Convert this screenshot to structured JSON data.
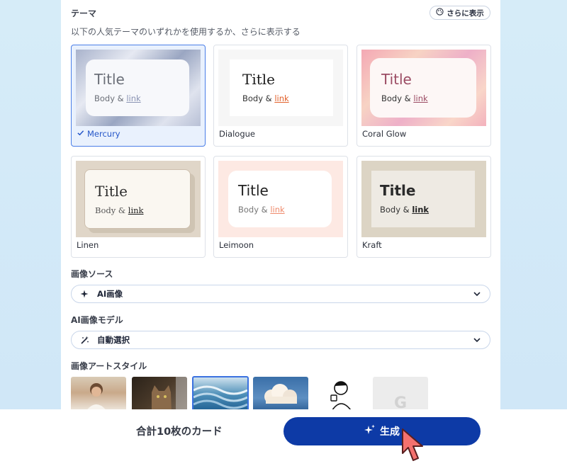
{
  "theme_section": {
    "title": "テーマ",
    "subtitle": "以下の人気テーマのいずれかを使用するか、さらに表示する",
    "more_button": "さらに表示",
    "more_icon": "palette-icon",
    "themes": [
      {
        "name": "Mercury",
        "title": "Title",
        "body": "Body &",
        "link": "link",
        "selected": true
      },
      {
        "name": "Dialogue",
        "title": "Title",
        "body": "Body &",
        "link": "link",
        "selected": false
      },
      {
        "name": "Coral Glow",
        "title": "Title",
        "body": "Body &",
        "link": "link",
        "selected": false
      },
      {
        "name": "Linen",
        "title": "Title",
        "body": "Body &",
        "link": "link",
        "selected": false
      },
      {
        "name": "Leimoon",
        "title": "Title",
        "body": "Body &",
        "link": "link",
        "selected": false
      },
      {
        "name": "Kraft",
        "title": "Title",
        "body": "Body &",
        "link": "link",
        "selected": false
      }
    ]
  },
  "image_source": {
    "label": "画像ソース",
    "value": "AI画像",
    "icon": "sparkle-icon"
  },
  "ai_model": {
    "label": "AI画像モデル",
    "value": "自動選択",
    "icon": "magic-wand-icon"
  },
  "art_style": {
    "label": "画像アートスタイル"
  },
  "footer": {
    "total": "合計10枚のカード",
    "generate": "生成"
  }
}
